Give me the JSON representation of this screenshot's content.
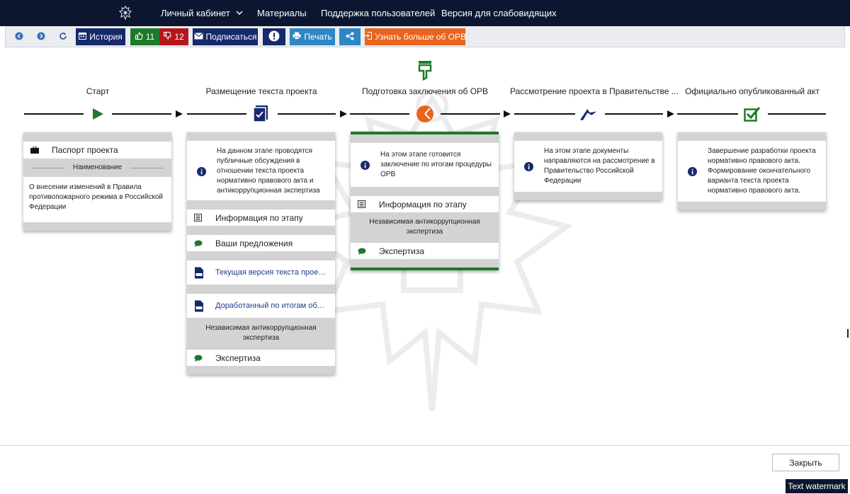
{
  "nav": {
    "emblem": "coat-of-arms-icon",
    "items": [
      "Личный кабинет",
      "Материалы",
      "Поддержка пользователей",
      "Версия для слабовидящих"
    ]
  },
  "toolbar": {
    "history": "История",
    "likes": "11",
    "dislikes": "12",
    "subscribe": "Подписаться",
    "print": "Печать",
    "learn_more": "Узнать больше об ОРВ"
  },
  "colors": {
    "navy": "#16296b",
    "green": "#1e7a2a",
    "red": "#b5161b",
    "blue": "#2f86c4",
    "orange": "#e8641e",
    "nav_bg": "#0c1630"
  },
  "stages": [
    {
      "title": "Старт",
      "icon": "play-icon"
    },
    {
      "title": "Размещение текста проекта",
      "icon": "document-check-icon"
    },
    {
      "title": "Подготовка заключения об ОРВ",
      "icon": "pie-progress-icon",
      "current": true
    },
    {
      "title": "Рассмотрение проекта в Правительстве ...",
      "icon": "flag-icon"
    },
    {
      "title": "Официально опубликованный акт",
      "icon": "checkbox-icon"
    }
  ],
  "cards": {
    "start": {
      "passport": "Паспорт проекта",
      "name_header": "Наименование",
      "name_text": "О внесении изменений в Правила противопожарного режима в Российской Федерации"
    },
    "posting": {
      "info": "На данном этапе проводятся публичные обсуждения в отношении текста проекта нормативно правового акта и антикоррупционная экспертиза",
      "stage_info": "Информация по этапу",
      "proposals": "Ваши предложения",
      "doc1": "Текущая версия текста проекта норм...",
      "doc2": "Доработанный по итогам обсуждени...",
      "section": "Независимая антикоррупционная экспертиза",
      "expertise": "Экспертиза"
    },
    "conclusion": {
      "info": "На этом этапе готовится заключение по итогам процедуры ОРВ",
      "stage_info": "Информация по этапу",
      "section": "Независимая антикоррупционная экспертиза",
      "expertise": "Экспертиза"
    },
    "government": {
      "info": "На этом этапе документы направляются на рассмотрение в Правительство Российской Федерации"
    },
    "published": {
      "info": "Завершение разработки проекта нормативно правового акта. Формирование окончательного варианта текста проекта нормативно правового акта."
    }
  },
  "footer": {
    "close": "Закрыть",
    "watermark": "Text watermark"
  }
}
